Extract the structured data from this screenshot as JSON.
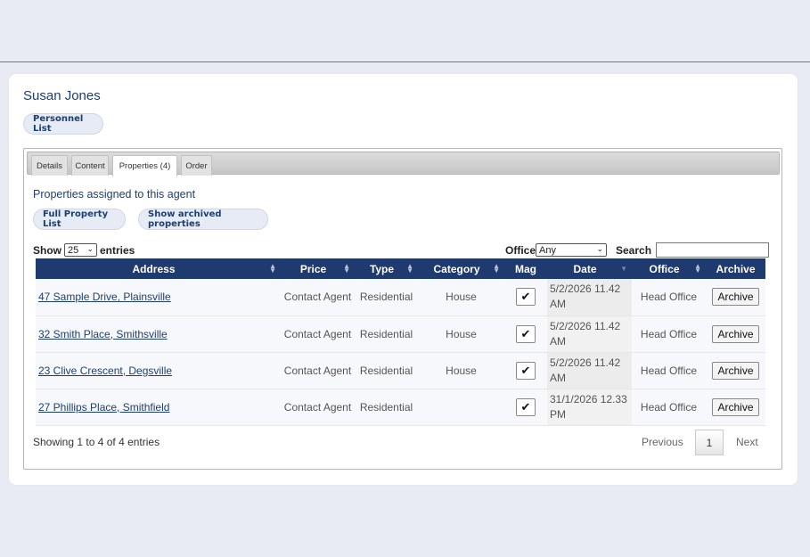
{
  "agent": {
    "name": "Susan Jones"
  },
  "buttons": {
    "personnel_list": "Personnel List",
    "full_property_list": "Full Property List",
    "show_archived": "Show archived properties"
  },
  "tabs": [
    {
      "label": "Details"
    },
    {
      "label": "Content"
    },
    {
      "label": "Properties (4)",
      "active": true
    },
    {
      "label": "Order"
    }
  ],
  "section_title": "Properties assigned to this agent",
  "controls": {
    "show_label": "Show",
    "entries_value": "25",
    "entries_label": "entries",
    "office_label": "Office",
    "office_value": "Any",
    "search_label": "Search",
    "search_value": ""
  },
  "table": {
    "headers": [
      "Address",
      "Price",
      "Type",
      "Category",
      "Mag",
      "Date",
      "Office",
      "Archive"
    ],
    "rows": [
      {
        "address": "47 Sample Drive, Plainsville",
        "price": "Contact Agent",
        "type": "Residential",
        "category": "House",
        "mag": "✔",
        "date": "5/2/2026 11.42 AM",
        "office": "Head Office",
        "archive": "Archive"
      },
      {
        "address": "32 Smith Place, Smithsville",
        "price": "Contact Agent",
        "type": "Residential",
        "category": "House",
        "mag": "✔",
        "date": "5/2/2026 11.42 AM",
        "office": "Head Office",
        "archive": "Archive"
      },
      {
        "address": "23 Clive Crescent, Degsville",
        "price": "Contact Agent",
        "type": "Residential",
        "category": "House",
        "mag": "✔",
        "date": "5/2/2026 11.42 AM",
        "office": "Head Office",
        "archive": "Archive"
      },
      {
        "address": "27 Phillips Place, Smithfield",
        "price": "Contact Agent",
        "type": "Residential",
        "category": "",
        "mag": "✔",
        "date": "31/1/2026 12.33 PM",
        "office": "Head Office",
        "archive": "Archive"
      }
    ]
  },
  "pagination": {
    "info": "Showing 1 to 4 of 4 entries",
    "previous": "Previous",
    "current": "1",
    "next": "Next"
  },
  "colors": {
    "header_bg": "#1e3a6e",
    "accent_text": "#1c3f72",
    "topbar_rule": "#c8584c"
  }
}
